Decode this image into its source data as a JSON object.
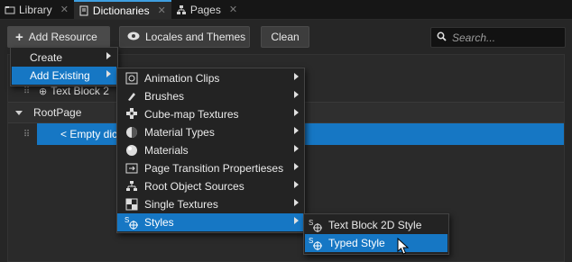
{
  "tabs": [
    {
      "label": "Library",
      "icon": "folder-icon",
      "active": false
    },
    {
      "label": "Dictionaries",
      "icon": "book-icon",
      "active": true
    },
    {
      "label": "Pages",
      "icon": "hierarchy-icon",
      "active": false
    }
  ],
  "toolbar": {
    "add_resource": "Add Resource",
    "locales_and_themes": "Locales and Themes",
    "clean": "Clean",
    "search_placeholder": "Search..."
  },
  "tree": {
    "row_partial": "Text Block 2",
    "root_page": "RootPage",
    "empty_item": "< Empty dic"
  },
  "menu_main": [
    {
      "label": "Create",
      "has_submenu": true
    },
    {
      "label": "Add Existing",
      "has_submenu": true,
      "highlighted": true
    }
  ],
  "menu_add_existing": [
    {
      "label": "Animation Clips",
      "icon": "animation-clip-icon"
    },
    {
      "label": "Brushes",
      "icon": "brush-icon"
    },
    {
      "label": "Cube-map Textures",
      "icon": "cubemap-icon"
    },
    {
      "label": "Material Types",
      "icon": "material-type-icon"
    },
    {
      "label": "Materials",
      "icon": "material-icon"
    },
    {
      "label": "Page Transition Propertieses",
      "icon": "page-transition-icon"
    },
    {
      "label": "Root Object Sources",
      "icon": "root-object-icon"
    },
    {
      "label": "Single Textures",
      "icon": "texture-icon"
    },
    {
      "label": "Styles",
      "icon": "style-icon",
      "highlighted": true
    }
  ],
  "menu_styles": [
    {
      "label": "Text Block 2D Style",
      "icon": "style-icon"
    },
    {
      "label": "Typed Style",
      "icon": "style-icon",
      "highlighted": true
    }
  ],
  "colors": {
    "accent": "#1677c4",
    "tab_indicator": "#3f9fe0"
  }
}
